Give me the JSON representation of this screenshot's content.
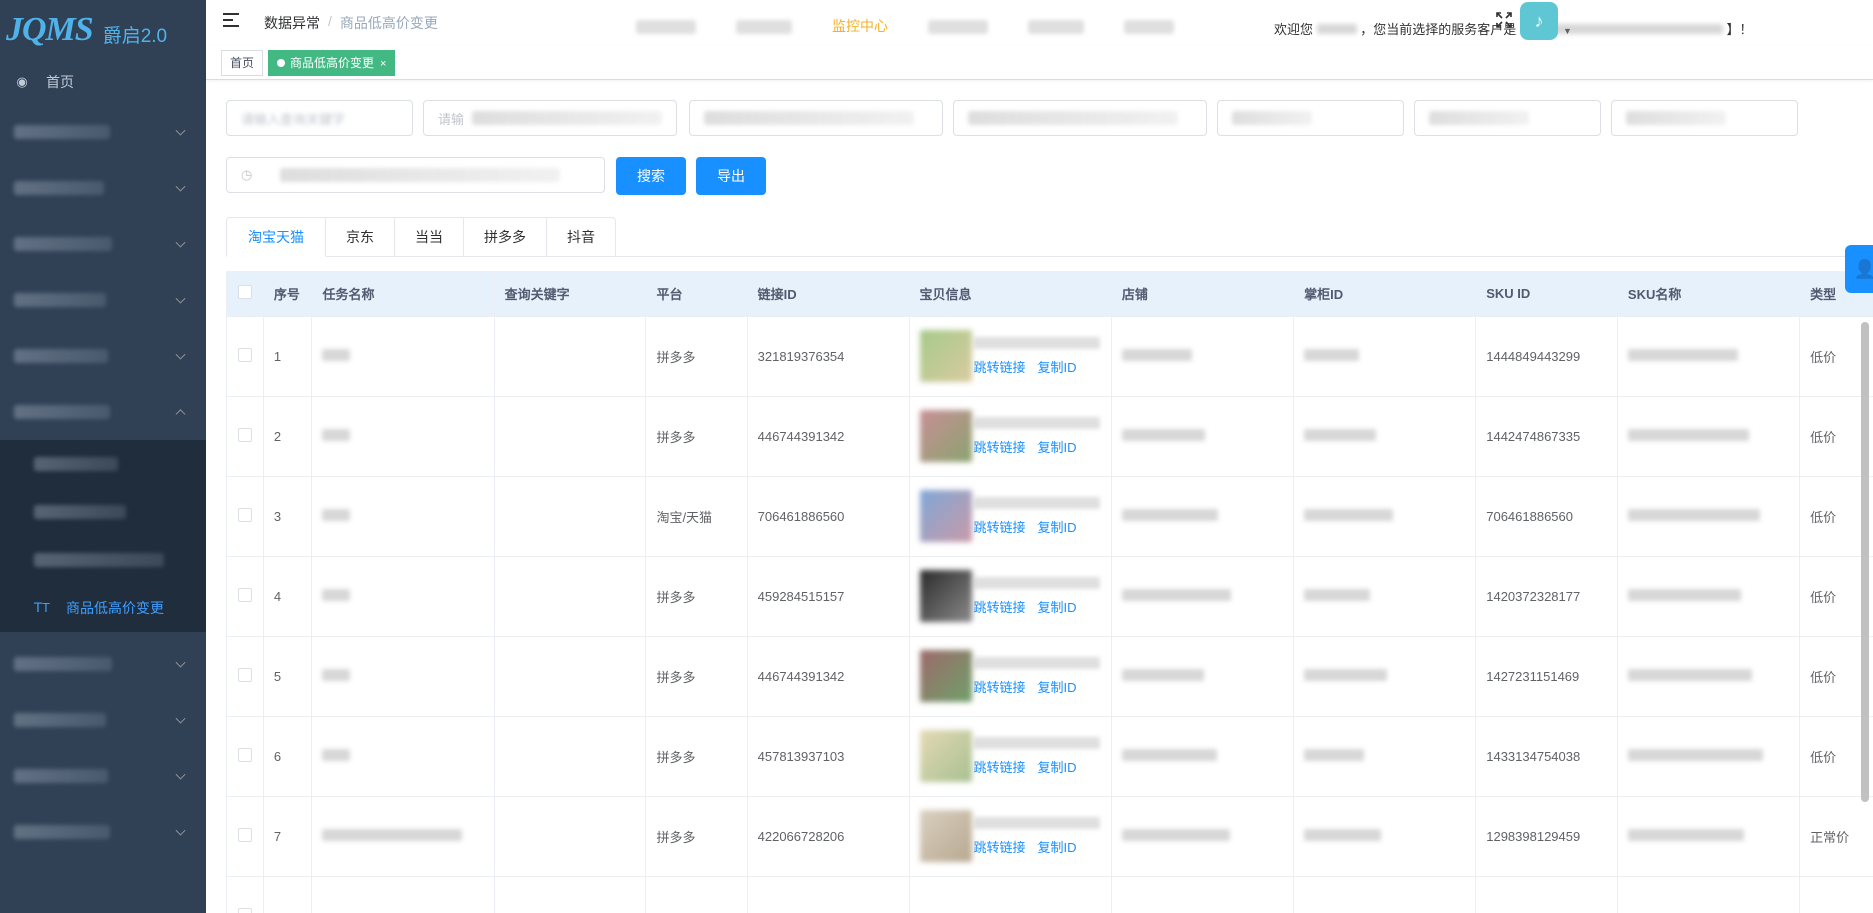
{
  "app": {
    "logo_mark": "JQMS",
    "logo_version": "爵启2.0"
  },
  "sidebar": {
    "home_label": "首页",
    "active_sub_label": "商品低高价变更"
  },
  "header": {
    "breadcrumb": [
      "数据异常",
      "商品低高价变更"
    ],
    "topnav_highlight": "监控中心",
    "welcome_prefix": "欢迎您",
    "welcome_mid": "，您当前选择的服务客户是【",
    "welcome_suffix": "】！"
  },
  "tags": {
    "home": "首页",
    "current": "商品低高价变更"
  },
  "filters": {
    "keyword_placeholder": "请输入查询关键字",
    "input2_placeholder": "请输"
  },
  "buttons": {
    "search": "搜索",
    "export": "导出"
  },
  "platform_tabs": [
    "淘宝天猫",
    "京东",
    "当当",
    "拼多多",
    "抖音"
  ],
  "table": {
    "columns": [
      "序号",
      "任务名称",
      "查询关键字",
      "平台",
      "链接ID",
      "宝贝信息",
      "店铺",
      "掌柜ID",
      "SKU ID",
      "SKU名称",
      "类型"
    ],
    "jump_link": "跳转链接",
    "copy_id": "复制ID",
    "rows": [
      {
        "no": "1",
        "platform": "拼多多",
        "link_id": "321819376354",
        "sku_id": "1444849443299",
        "type": "低价"
      },
      {
        "no": "2",
        "platform": "拼多多",
        "link_id": "446744391342",
        "sku_id": "1442474867335",
        "type": "低价"
      },
      {
        "no": "3",
        "platform": "淘宝/天猫",
        "link_id": "706461886560",
        "sku_id": "706461886560",
        "type": "低价"
      },
      {
        "no": "4",
        "platform": "拼多多",
        "link_id": "459284515157",
        "sku_id": "1420372328177",
        "type": "低价"
      },
      {
        "no": "5",
        "platform": "拼多多",
        "link_id": "446744391342",
        "sku_id": "1427231151469",
        "type": "低价"
      },
      {
        "no": "6",
        "platform": "拼多多",
        "link_id": "457813937103",
        "sku_id": "1433134754038",
        "type": "低价"
      },
      {
        "no": "7",
        "platform": "拼多多",
        "link_id": "422066728206",
        "sku_id": "1298398129459",
        "type": "正常价"
      }
    ]
  },
  "colors": {
    "sidebar_bg": "#304156",
    "primary": "#1890ff",
    "tag_active": "#42b983",
    "highlight": "#f5b227"
  }
}
